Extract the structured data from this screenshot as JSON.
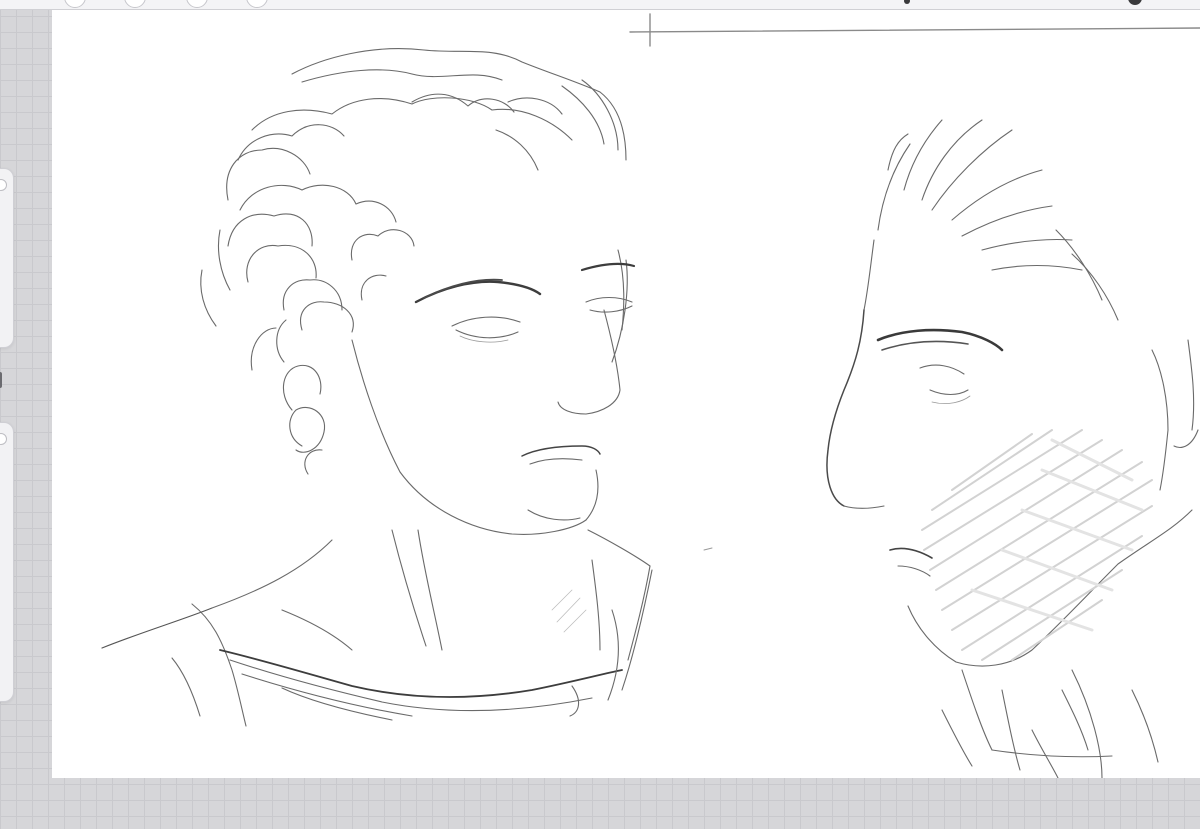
{
  "app": {
    "accent_color": "#3a3a3c",
    "canvas_color": "#ffffff",
    "background_color": "#d6d6d9"
  },
  "toolbar": {
    "buttons": [
      {
        "icon": "gallery-icon"
      },
      {
        "icon": "actions-icon"
      },
      {
        "icon": "adjustments-icon"
      },
      {
        "icon": "selection-icon"
      }
    ],
    "right_icons": [
      {
        "icon": "layers-icon"
      },
      {
        "icon": "color-icon"
      }
    ]
  },
  "sidebar": {
    "sliders": [
      {
        "name": "brush-size",
        "icon": "brush-size-slider-icon"
      },
      {
        "name": "opacity",
        "icon": "opacity-slider-icon"
      }
    ],
    "modify_button": {
      "icon": "modify-button-icon"
    }
  },
  "canvas": {
    "subjects": [
      "left-portrait-sketch",
      "right-profile-sketch"
    ]
  }
}
